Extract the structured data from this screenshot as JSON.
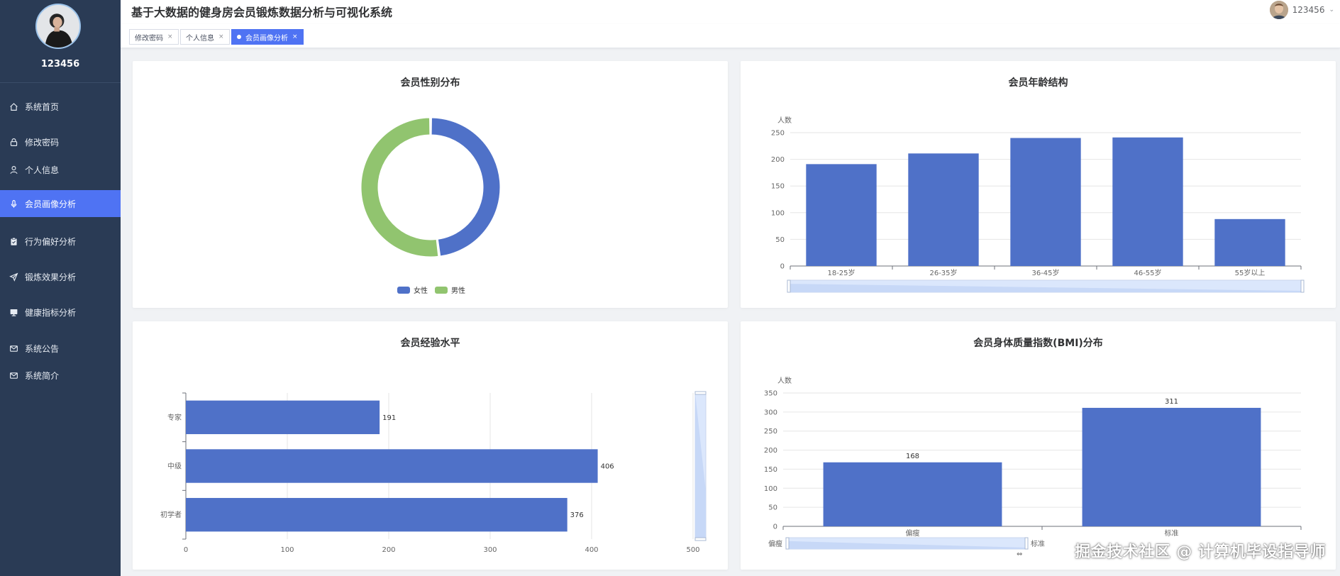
{
  "app": {
    "title": "基于大数据的健身房会员锻炼数据分析与可视化系统"
  },
  "sidebar": {
    "username": "123456",
    "items": [
      {
        "label": "系统首页",
        "icon": "home-icon"
      },
      {
        "label": "修改密码",
        "icon": "lock-icon"
      },
      {
        "label": "个人信息",
        "icon": "user-icon"
      },
      {
        "label": "会员画像分析",
        "icon": "microphone-icon",
        "active": true
      },
      {
        "label": "行为偏好分析",
        "icon": "clipboard-icon"
      },
      {
        "label": "锻炼效果分析",
        "icon": "send-icon"
      },
      {
        "label": "健康指标分析",
        "icon": "monitor-icon"
      },
      {
        "label": "系统公告",
        "icon": "mail-icon"
      },
      {
        "label": "系统简介",
        "icon": "mail-icon"
      }
    ]
  },
  "header": {
    "username": "123456"
  },
  "tags": [
    {
      "label": "修改密码",
      "close": "×"
    },
    {
      "label": "个人信息",
      "close": "×"
    },
    {
      "label": "会员画像分析",
      "close": "×",
      "active": true
    }
  ],
  "colors": {
    "accent": "#4f73f3",
    "sidebar": "#2a3b55",
    "series_blue": "#4f71c8",
    "series_green": "#91c46f"
  },
  "panels": {
    "gender": {
      "title": "会员性别分布"
    },
    "age": {
      "title": "会员年龄结构"
    },
    "experience": {
      "title": "会员经验水平"
    },
    "bmi": {
      "title": "会员身体质量指数(BMI)分布"
    }
  },
  "chart_data": [
    {
      "type": "pie",
      "title": "会员性别分布",
      "legend_position": "bottom",
      "categories": [
        "女性",
        "男性"
      ],
      "values": [
        48,
        52
      ],
      "colors": [
        "#4f71c8",
        "#91c46f"
      ]
    },
    {
      "type": "bar",
      "title": "会员年龄结构",
      "ylabel": "人数",
      "categories": [
        "18-25岁",
        "26-35岁",
        "36-45岁",
        "46-55岁",
        "55岁以上"
      ],
      "values": [
        191,
        211,
        240,
        241,
        88
      ],
      "ylim": [
        0,
        250
      ],
      "yticks": [
        0,
        50,
        100,
        150,
        200,
        250
      ],
      "grid": true
    },
    {
      "type": "bar",
      "orientation": "horizontal",
      "title": "会员经验水平",
      "categories": [
        "初学者",
        "中级",
        "专家"
      ],
      "values": [
        376,
        406,
        191
      ],
      "xlim": [
        0,
        500
      ],
      "xticks": [
        0,
        100,
        200,
        300,
        400,
        500
      ],
      "data_labels": true,
      "grid": true
    },
    {
      "type": "bar",
      "title": "会员身体质量指数(BMI)分布",
      "ylabel": "人数",
      "categories": [
        "偏瘦",
        "标准"
      ],
      "values": [
        168,
        311
      ],
      "ylim": [
        0,
        350
      ],
      "yticks": [
        0,
        50,
        100,
        150,
        200,
        250,
        300,
        350
      ],
      "data_labels": true,
      "grid": true
    }
  ],
  "watermark": "掘金技术社区 @ 计算机毕设指导师"
}
